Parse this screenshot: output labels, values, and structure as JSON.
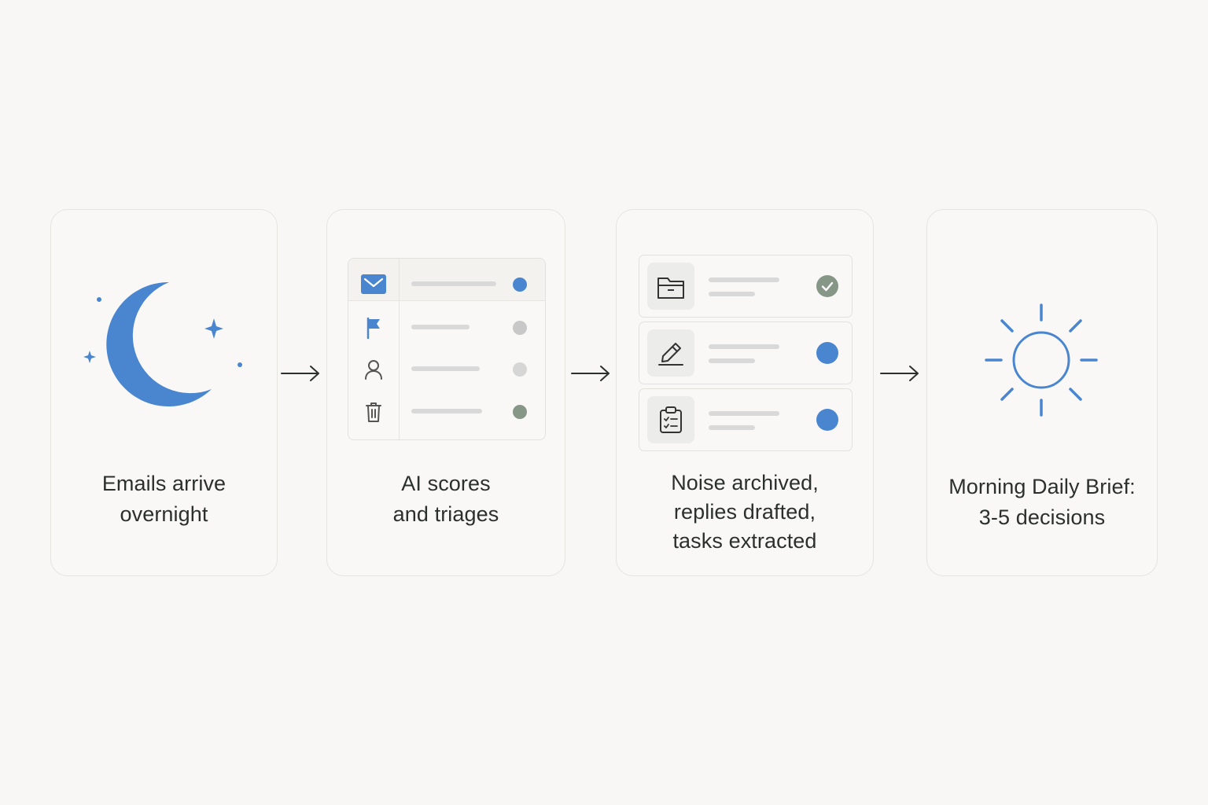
{
  "steps": [
    {
      "caption": [
        "Emails arrive",
        "overnight"
      ],
      "icon": "moon-with-stars-icon"
    },
    {
      "caption": [
        "AI scores",
        "and triages"
      ],
      "icon": "inbox-list",
      "rows": [
        {
          "icon": "mail-icon",
          "dot_color": "#4a86d0"
        },
        {
          "icon": "flag-icon",
          "dot_color": "#c8c8c8"
        },
        {
          "icon": "person-icon",
          "dot_color": "#d6d6d6"
        },
        {
          "icon": "trash-icon",
          "dot_color": "#879787"
        }
      ]
    },
    {
      "caption": [
        "Noise archived,",
        "replies drafted,",
        "tasks extracted"
      ],
      "icon": "action-list",
      "rows": [
        {
          "icon": "archive-folder-icon",
          "status": "check",
          "status_color": "#879787"
        },
        {
          "icon": "pencil-icon",
          "status": "dot",
          "status_color": "#4a86d0"
        },
        {
          "icon": "clipboard-checklist-icon",
          "status": "dot",
          "status_color": "#4a86d0"
        }
      ]
    },
    {
      "caption": [
        "Morning Daily Brief:",
        "3-5 decisions"
      ],
      "icon": "sun-icon"
    }
  ],
  "colors": {
    "accent": "#4a86d0",
    "muted_green": "#879787",
    "text": "#2c302d",
    "line_gray": "#d9d9d9"
  }
}
